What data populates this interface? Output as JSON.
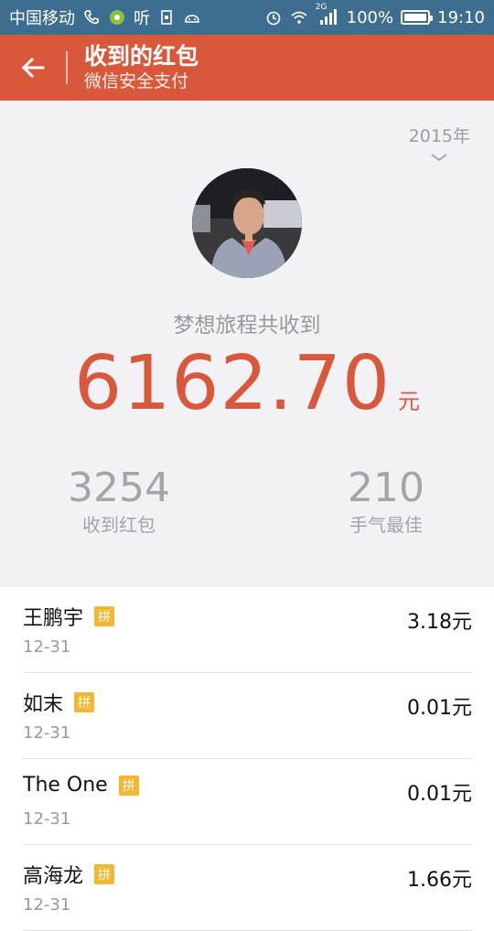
{
  "status_bar": {
    "carrier": "中国移动",
    "ting_label": "听",
    "network_label": "2G",
    "battery_level": "100%",
    "battery_fraction": 1.0,
    "time": "19:10"
  },
  "header": {
    "title": "收到的红包",
    "subtitle": "微信安全支付",
    "color": "#d9583b"
  },
  "summary": {
    "year": "2015年",
    "total_label": "梦想旅程共收到",
    "total_amount": "6162.70",
    "total_unit": "元",
    "received_count": "3254",
    "received_label": "收到红包",
    "best_luck_count": "210",
    "best_luck_label": "手气最佳"
  },
  "list": {
    "items": [
      {
        "name": "王鹏宇",
        "badge": "拼",
        "date": "12-31",
        "amount": "3.18元"
      },
      {
        "name": "如末",
        "badge": "拼",
        "date": "12-31",
        "amount": "0.01元"
      },
      {
        "name": "The One",
        "badge": "拼",
        "date": "12-31",
        "amount": "0.01元"
      },
      {
        "name": "高海龙",
        "badge": "拼",
        "date": "12-31",
        "amount": "1.66元"
      }
    ]
  }
}
